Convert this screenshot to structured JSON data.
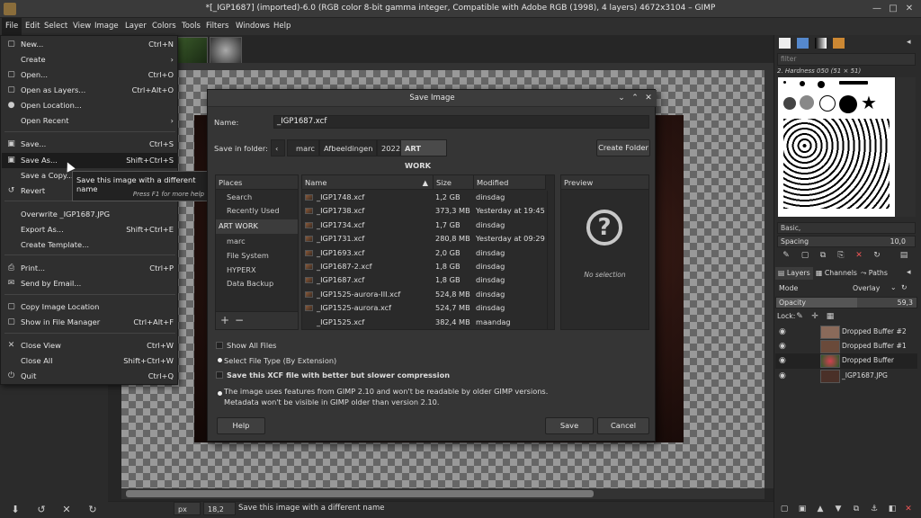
{
  "window": {
    "title": "*[_IGP1687] (imported)-6.0 (RGB color 8-bit gamma integer, Compatible with Adobe RGB (1998), 4 layers) 4672x3104 – GIMP",
    "min": "—",
    "max": "□",
    "close": "✕"
  },
  "menubar": [
    "File",
    "Edit",
    "Select",
    "View",
    "Image",
    "Layer",
    "Colors",
    "Tools",
    "Filters",
    "Windows",
    "Help"
  ],
  "file_menu": [
    {
      "label": "New...",
      "accel": "Ctrl+N",
      "icon": "▢"
    },
    {
      "label": "Create",
      "accel": "›",
      "icon": ""
    },
    {
      "label": "Open...",
      "accel": "Ctrl+O",
      "icon": "▢"
    },
    {
      "label": "Open as Layers...",
      "accel": "Ctrl+Alt+O",
      "icon": "▢"
    },
    {
      "label": "Open Location...",
      "accel": "",
      "icon": "●"
    },
    {
      "label": "Open Recent",
      "accel": "›",
      "icon": ""
    },
    {
      "label": "Save...",
      "accel": "Ctrl+S",
      "icon": "▣"
    },
    {
      "label": "Save As...",
      "accel": "Shift+Ctrl+S",
      "icon": "▣"
    },
    {
      "label": "Save a Copy...",
      "accel": "",
      "icon": ""
    },
    {
      "label": "Revert",
      "accel": "",
      "icon": "↺"
    },
    {
      "label": "Overwrite _IGP1687.JPG",
      "accel": "",
      "icon": ""
    },
    {
      "label": "Export As...",
      "accel": "Shift+Ctrl+E",
      "icon": ""
    },
    {
      "label": "Create Template...",
      "accel": "",
      "icon": ""
    },
    {
      "label": "Print...",
      "accel": "Ctrl+P",
      "icon": "⎙"
    },
    {
      "label": "Send by Email...",
      "accel": "",
      "icon": "✉"
    },
    {
      "label": "Copy Image Location",
      "accel": "",
      "icon": "▢"
    },
    {
      "label": "Show in File Manager",
      "accel": "Ctrl+Alt+F",
      "icon": "▢"
    },
    {
      "label": "Close View",
      "accel": "Ctrl+W",
      "icon": "✕"
    },
    {
      "label": "Close All",
      "accel": "Shift+Ctrl+W",
      "icon": ""
    },
    {
      "label": "Quit",
      "accel": "Ctrl+Q",
      "icon": "⏻"
    }
  ],
  "tooltip": {
    "text": "Save this image with a different name",
    "hint": "Press F1 for more help"
  },
  "dialog": {
    "title": "Save Image",
    "name_label": "Name:",
    "name_value": "_IGP1687.xcf",
    "folder_label": "Save in folder:",
    "crumbs": [
      "marc",
      "Afbeeldingen",
      "2022",
      "ART WORK"
    ],
    "create_folder": "Create Folder",
    "places_header": "Places",
    "places": [
      "Search",
      "Recently Used",
      "ART WORK",
      "marc",
      "File System",
      "HYPERX",
      "Data Backup"
    ],
    "columns": {
      "name": "Name",
      "size": "Size",
      "modified": "Modified"
    },
    "files": [
      {
        "name": "_IGP1748.xcf",
        "size": "1,2 GB",
        "modified": "dinsdag"
      },
      {
        "name": "_IGP1738.xcf",
        "size": "373,3 MB",
        "modified": "Yesterday at 19:45"
      },
      {
        "name": "_IGP1734.xcf",
        "size": "1,7 GB",
        "modified": "dinsdag"
      },
      {
        "name": "_IGP1731.xcf",
        "size": "280,8 MB",
        "modified": "Yesterday at 09:29"
      },
      {
        "name": "_IGP1693.xcf",
        "size": "2,0 GB",
        "modified": "dinsdag"
      },
      {
        "name": "_IGP1687-2.xcf",
        "size": "1,8 GB",
        "modified": "dinsdag"
      },
      {
        "name": "_IGP1687.xcf",
        "size": "1,8 GB",
        "modified": "dinsdag"
      },
      {
        "name": "_IGP1525-aurora-III.xcf",
        "size": "524,8 MB",
        "modified": "dinsdag"
      },
      {
        "name": "_IGP1525-aurora.xcf",
        "size": "524,7 MB",
        "modified": "dinsdag"
      },
      {
        "name": "_IGP1525.xcf",
        "size": "382,4 MB",
        "modified": "maandag"
      }
    ],
    "preview_header": "Preview",
    "preview_none": "No selection",
    "show_all": "Show All Files",
    "select_type": "Select File Type (By Extension)",
    "compress": "Save this XCF file with better but slower compression",
    "warning1": "The image uses features from GIMP 2.10 and won't be readable by older GIMP versions.",
    "warning2": "Metadata won't be visible in GIMP older than version 2.10.",
    "help": "Help",
    "save": "Save",
    "cancel": "Cancel"
  },
  "statusbar": {
    "unit": "px",
    "zoom": "18,2 %",
    "message": "Save this image with a different name"
  },
  "dock": {
    "filter_placeholder": "filter",
    "brush_name": "2. Hardness 050 (51 × 51)",
    "brush_set": "Basic,",
    "spacing_label": "Spacing",
    "spacing_value": "10,0",
    "tabs": [
      "Layers",
      "Channels",
      "Paths"
    ],
    "mode_label": "Mode",
    "mode_value": "Overlay",
    "opacity_label": "Opacity",
    "opacity_value": "59,3",
    "lock_label": "Lock:",
    "layers": [
      {
        "name": "Dropped Buffer #2",
        "color": "#8a6a5a"
      },
      {
        "name": "Dropped Buffer #1",
        "color": "#6a4a3a"
      },
      {
        "name": "Dropped Buffer",
        "color": "#d04050"
      },
      {
        "name": "_IGP1687.JPG",
        "color": "#4a3028"
      }
    ]
  }
}
